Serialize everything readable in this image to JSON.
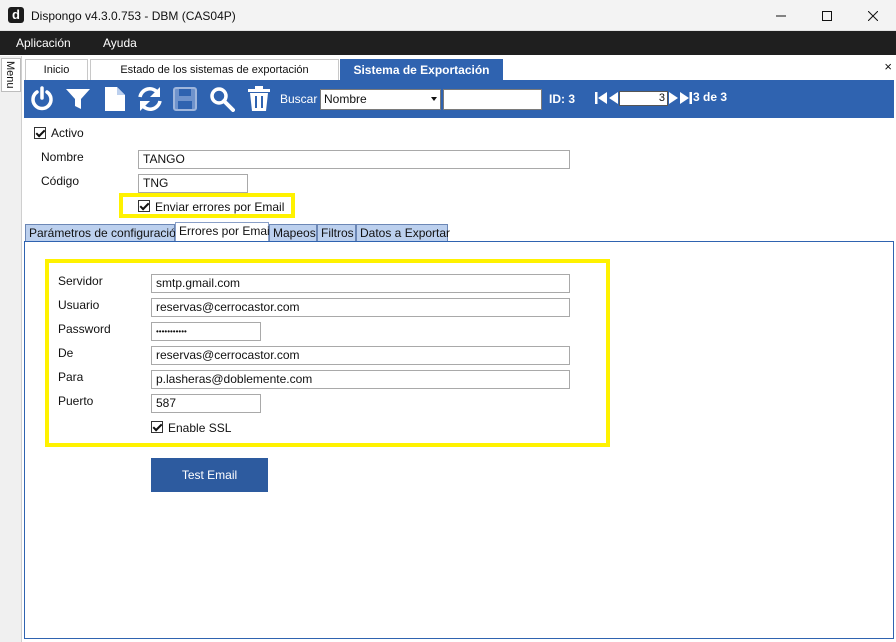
{
  "window": {
    "title": "Dispongo v4.3.0.753 - DBM (CAS04P)",
    "logo_letter": "d"
  },
  "menubar": {
    "items": [
      "Aplicación",
      "Ayuda"
    ]
  },
  "side_menu": {
    "label": "Menu"
  },
  "tabs": {
    "items": [
      "Inicio",
      "Estado de los sistemas de exportación",
      "Sistema de Exportación"
    ],
    "active_index": 2,
    "close_glyph": "×"
  },
  "toolbar": {
    "icons": [
      "power-icon",
      "filter-icon",
      "new-document-icon",
      "refresh-icon",
      "save-icon",
      "search-icon",
      "delete-icon"
    ],
    "search_label": "Buscar",
    "search_field_selected": "Nombre",
    "search_text": "",
    "id_label": "ID: 3",
    "record_current": "3",
    "record_of": "3 de 3",
    "accent_color": "#2f63b0"
  },
  "form": {
    "activo_label": "Activo",
    "activo_checked": true,
    "nombre_label": "Nombre",
    "nombre_value": "TANGO",
    "codigo_label": "Código",
    "codigo_value": "TNG",
    "enviar_errores_label": "Enviar errores por Email",
    "enviar_errores_checked": true
  },
  "inner_tabs": {
    "items": [
      "Parámetros de configuración",
      "Errores por Email",
      "Mapeos",
      "Filtros",
      "Datos a Exportar"
    ],
    "active_index": 1
  },
  "email": {
    "servidor_label": "Servidor",
    "servidor_value": "smtp.gmail.com",
    "usuario_label": "Usuario",
    "usuario_value": "reservas@cerrocastor.com",
    "password_label": "Password",
    "password_value": "•••••••••••",
    "de_label": "De",
    "de_value": "reservas@cerrocastor.com",
    "para_label": "Para",
    "para_value": "p.lasheras@doblemente.com",
    "puerto_label": "Puerto",
    "puerto_value": "587",
    "ssl_label": "Enable SSL",
    "ssl_checked": true,
    "test_button": "Test Email"
  },
  "highlight_color": "#fff200"
}
